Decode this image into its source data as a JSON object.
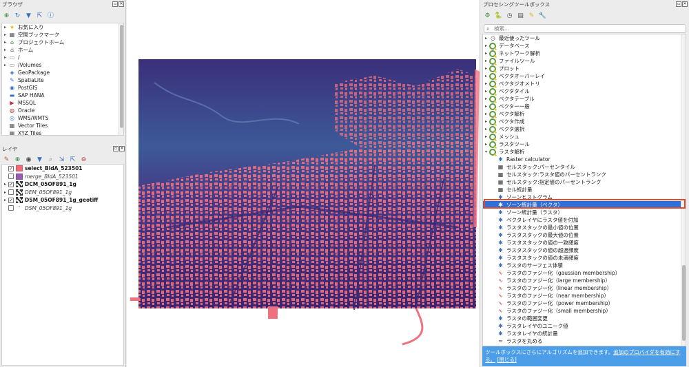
{
  "browser": {
    "title": "ブラウザ",
    "items": [
      {
        "label": "お気に入り",
        "icon": "star-icon",
        "arrow": "▸"
      },
      {
        "label": "空間ブックマーク",
        "icon": "bookmark-icon",
        "arrow": "▸"
      },
      {
        "label": "プロジェクトホーム",
        "icon": "project-home-icon",
        "arrow": "▸"
      },
      {
        "label": "ホーム",
        "icon": "home-folder-icon",
        "arrow": "▸"
      },
      {
        "label": "/",
        "icon": "folder-icon",
        "arrow": "▸"
      },
      {
        "label": "/Volumes",
        "icon": "folder-icon",
        "arrow": "▸"
      },
      {
        "label": "GeoPackage",
        "icon": "geopackage-icon",
        "arrow": ""
      },
      {
        "label": "SpatiaLite",
        "icon": "spatialite-icon",
        "arrow": ""
      },
      {
        "label": "PostGIS",
        "icon": "postgis-icon",
        "arrow": ""
      },
      {
        "label": "SAP HANA",
        "icon": "sap-hana-icon",
        "arrow": ""
      },
      {
        "label": "MSSQL",
        "icon": "mssql-icon",
        "arrow": ""
      },
      {
        "label": "Oracle",
        "icon": "oracle-icon",
        "arrow": ""
      },
      {
        "label": "WMS/WMTS",
        "icon": "wms-icon",
        "arrow": ""
      },
      {
        "label": "Vector Tiles",
        "icon": "vector-tiles-icon",
        "arrow": ""
      },
      {
        "label": "XYZ Tiles",
        "icon": "xyz-tiles-icon",
        "arrow": ""
      }
    ]
  },
  "layers": {
    "title": "レイヤ",
    "items": [
      {
        "label": "select_BldA_523501",
        "checked": true,
        "style": "bold",
        "swatch": "#f06a7a",
        "arrow": ""
      },
      {
        "label": "merge_BldA_523501",
        "checked": false,
        "style": "italic",
        "swatch": "#9b59b6",
        "arrow": ""
      },
      {
        "label": "DCM_05OF891_1g",
        "checked": true,
        "style": "bold",
        "swatch": "raster",
        "arrow": "▸"
      },
      {
        "label": "DEM_05OF891_1g",
        "checked": false,
        "style": "italic",
        "swatch": "raster",
        "arrow": "▸"
      },
      {
        "label": "DSM_05OF891_1g_geotiff",
        "checked": true,
        "style": "bold",
        "swatch": "raster",
        "arrow": "▸"
      },
      {
        "label": "DSM_05OF891_1g",
        "checked": false,
        "style": "italic",
        "swatch": "dot",
        "arrow": ""
      }
    ]
  },
  "processing": {
    "title": "プロセシングツールボックス",
    "search_placeholder": "検索...",
    "groups": [
      {
        "label": "最近使ったツール",
        "icon": "clock-icon"
      },
      {
        "label": "データベース",
        "icon": "qgis-icon"
      },
      {
        "label": "ネットワーク解析",
        "icon": "qgis-icon"
      },
      {
        "label": "ファイルツール",
        "icon": "qgis-icon"
      },
      {
        "label": "プロット",
        "icon": "qgis-icon"
      },
      {
        "label": "ベクタオーバーレイ",
        "icon": "qgis-icon"
      },
      {
        "label": "ベクタジオメトリ",
        "icon": "qgis-icon"
      },
      {
        "label": "ベクタタイル",
        "icon": "qgis-icon"
      },
      {
        "label": "ベクタテーブル",
        "icon": "qgis-icon"
      },
      {
        "label": "ベクター一般",
        "icon": "qgis-icon"
      },
      {
        "label": "ベクタ解析",
        "icon": "qgis-icon"
      },
      {
        "label": "ベクタ作成",
        "icon": "qgis-icon"
      },
      {
        "label": "ベクタ選択",
        "icon": "qgis-icon"
      },
      {
        "label": "メッシュ",
        "icon": "qgis-icon"
      },
      {
        "label": "ラスタツール",
        "icon": "qgis-icon"
      },
      {
        "label": "ラスタ解析",
        "icon": "qgis-icon",
        "expanded": true
      }
    ],
    "algorithms": [
      {
        "label": "Raster calculator",
        "icon": "gear-icon"
      },
      {
        "label": "セルスタック:パーセンタイル",
        "icon": "cell-icon"
      },
      {
        "label": "セルスタック:ラスタ値のパーセントランク",
        "icon": "cell-icon"
      },
      {
        "label": "セルスタック:指定値のパーセントランク",
        "icon": "cell-icon"
      },
      {
        "label": "セル統計量",
        "icon": "cell-icon"
      },
      {
        "label": "ゾーンヒストグラム",
        "icon": "gear-icon"
      },
      {
        "label": "ゾーン統計量（ベクタ）",
        "icon": "gear-icon",
        "selected": true
      },
      {
        "label": "ゾーン統計量（ラスタ）",
        "icon": "gear-icon"
      },
      {
        "label": "ベクタレイヤにラスタ値を付加",
        "icon": "gear-icon"
      },
      {
        "label": "ラスタスタックの最小値の位置",
        "icon": "gear-icon"
      },
      {
        "label": "ラスタスタックの最大値の位置",
        "icon": "gear-icon"
      },
      {
        "label": "ラスタスタックの値の一致頻度",
        "icon": "gear-icon"
      },
      {
        "label": "ラスタスタックの値の超過頻度",
        "icon": "gear-icon"
      },
      {
        "label": "ラスタスタックの値の未満頻度",
        "icon": "gear-icon"
      },
      {
        "label": "ラスタのサーフェス体積",
        "icon": "gear-icon"
      },
      {
        "label": "ラスタのファジー化（gaussian membership）",
        "icon": "fuzzy-icon"
      },
      {
        "label": "ラスタのファジー化（large membership）",
        "icon": "fuzzy-icon"
      },
      {
        "label": "ラスタのファジー化（linear membership）",
        "icon": "fuzzy-icon"
      },
      {
        "label": "ラスタのファジー化（near membership）",
        "icon": "fuzzy-icon"
      },
      {
        "label": "ラスタのファジー化（power membership）",
        "icon": "fuzzy-icon"
      },
      {
        "label": "ラスタのファジー化（small membership）",
        "icon": "fuzzy-icon"
      },
      {
        "label": "ラスタの範囲変更",
        "icon": "gear-icon"
      },
      {
        "label": "ラスタレイヤのユニーク値",
        "icon": "gear-icon"
      },
      {
        "label": "ラスタレイヤの統計量",
        "icon": "gear-icon"
      },
      {
        "label": "ラスタを丸める",
        "icon": "round-icon"
      }
    ],
    "info_text": "ツールボックスにさらにアルゴリズムを追加できます。",
    "info_link": "追加のプロバイダを有効にする。",
    "info_close": "[閉じる]"
  },
  "colors": {
    "building": "#f07080",
    "raster_dark": "#3b2a78",
    "raster_mid": "#3a5a9a",
    "selection": "#2e6fd8",
    "highlight": "#e24b2c",
    "info_bar": "#4c9ee8"
  }
}
